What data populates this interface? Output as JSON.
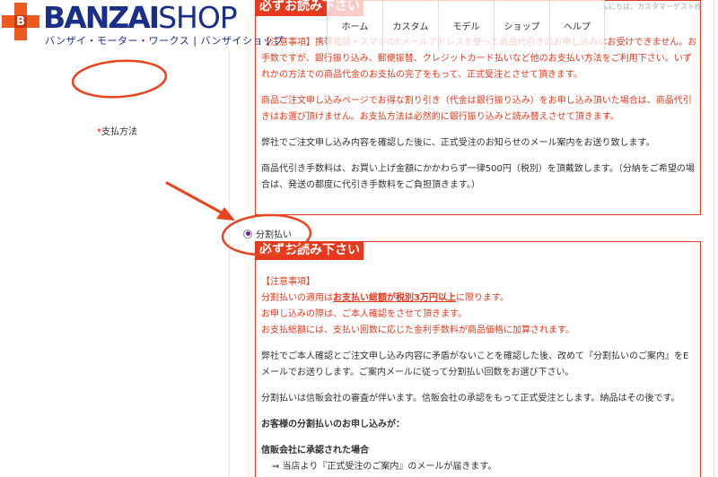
{
  "logo": {
    "mark_letter": "B",
    "name_part1": "BANZAI",
    "name_part2": "SHOP",
    "tagline": "バンザイ・モーター・ワークス | バンザイショップ"
  },
  "nav": {
    "items": [
      "ホーム",
      "カスタム",
      "モデル",
      "ショップ",
      "ヘルプ"
    ],
    "welcome": "こんにちは、カスタマーゲスト様"
  },
  "form": {
    "payment_label": "支払方法",
    "required_mark": "*"
  },
  "notice1": {
    "title": "必ずお読み下さい",
    "p1": "【注意事項】携帯電話・スマホのEメールアドレスを使って商品代引きのお申し込みはお受けできません。お手数ですが、銀行振り込み、郵便振替、クレジットカード払いなど他のお支払い方法をご利用下さい。いずれかの方法での商品代金のお支払の完了をもって、正式受注とさせて頂きます。",
    "p2": "商品ご注文申し込みページでお得な割り引き（代金は銀行振り込み）をお申し込み頂いた場合は、商品代引きはお選び頂けません。お支払方法は必然的に銀行振り込みと読み替えさせて頂きます。",
    "p3": "弊社でご注文申し込み内容を確認した後に、正式受注のお知らせのメール案内をお送り致します。",
    "p4": "商品代引き手数料は、お買い上げ金額にかかわらず一律500円（税別）を頂戴致します。（分納をご希望の場合は、発送の都度に代引き手数料をご負担頂きます。）"
  },
  "installment": {
    "radio_label": "分割払い",
    "selected": true
  },
  "notice2": {
    "title": "必ずお読み下さい",
    "note_head": "【注意事項】",
    "line1_pre": "分割払いの適用は",
    "line1_emph": "お支払い総額が税別3万円以上",
    "line1_post": "に限ります。",
    "line2": "お申し込みの際は、ご本人確認をさせて頂きます。",
    "line3": "お支払総額には、支払い回数に応じた金利手数料が商品価格に加算されます。",
    "p2": "弊社でご本人確認とご注文申し込み内容に矛盾がないことを確認した後、改めて『分割払いのご案内』をEメールでお送りします。ご案内メールに従って分割払い回数をお選び下さい。",
    "p3": "分割払いは信販会社の審査が伴います。信販会社の承認をもって正式受注とします。納品はその後です。",
    "p4": "お客様の分割払いのお申し込みが：",
    "p5_head": "信販会社に承認された場合",
    "p5_line": "⇒ 当店より『正式受注のご案内』のメールが届きます。"
  },
  "colors": {
    "notice_red": "#e53a1e",
    "brand_navy": "#1a2f8a",
    "brand_orange": "#f05a1e",
    "annotation_red": "#e8441e"
  }
}
